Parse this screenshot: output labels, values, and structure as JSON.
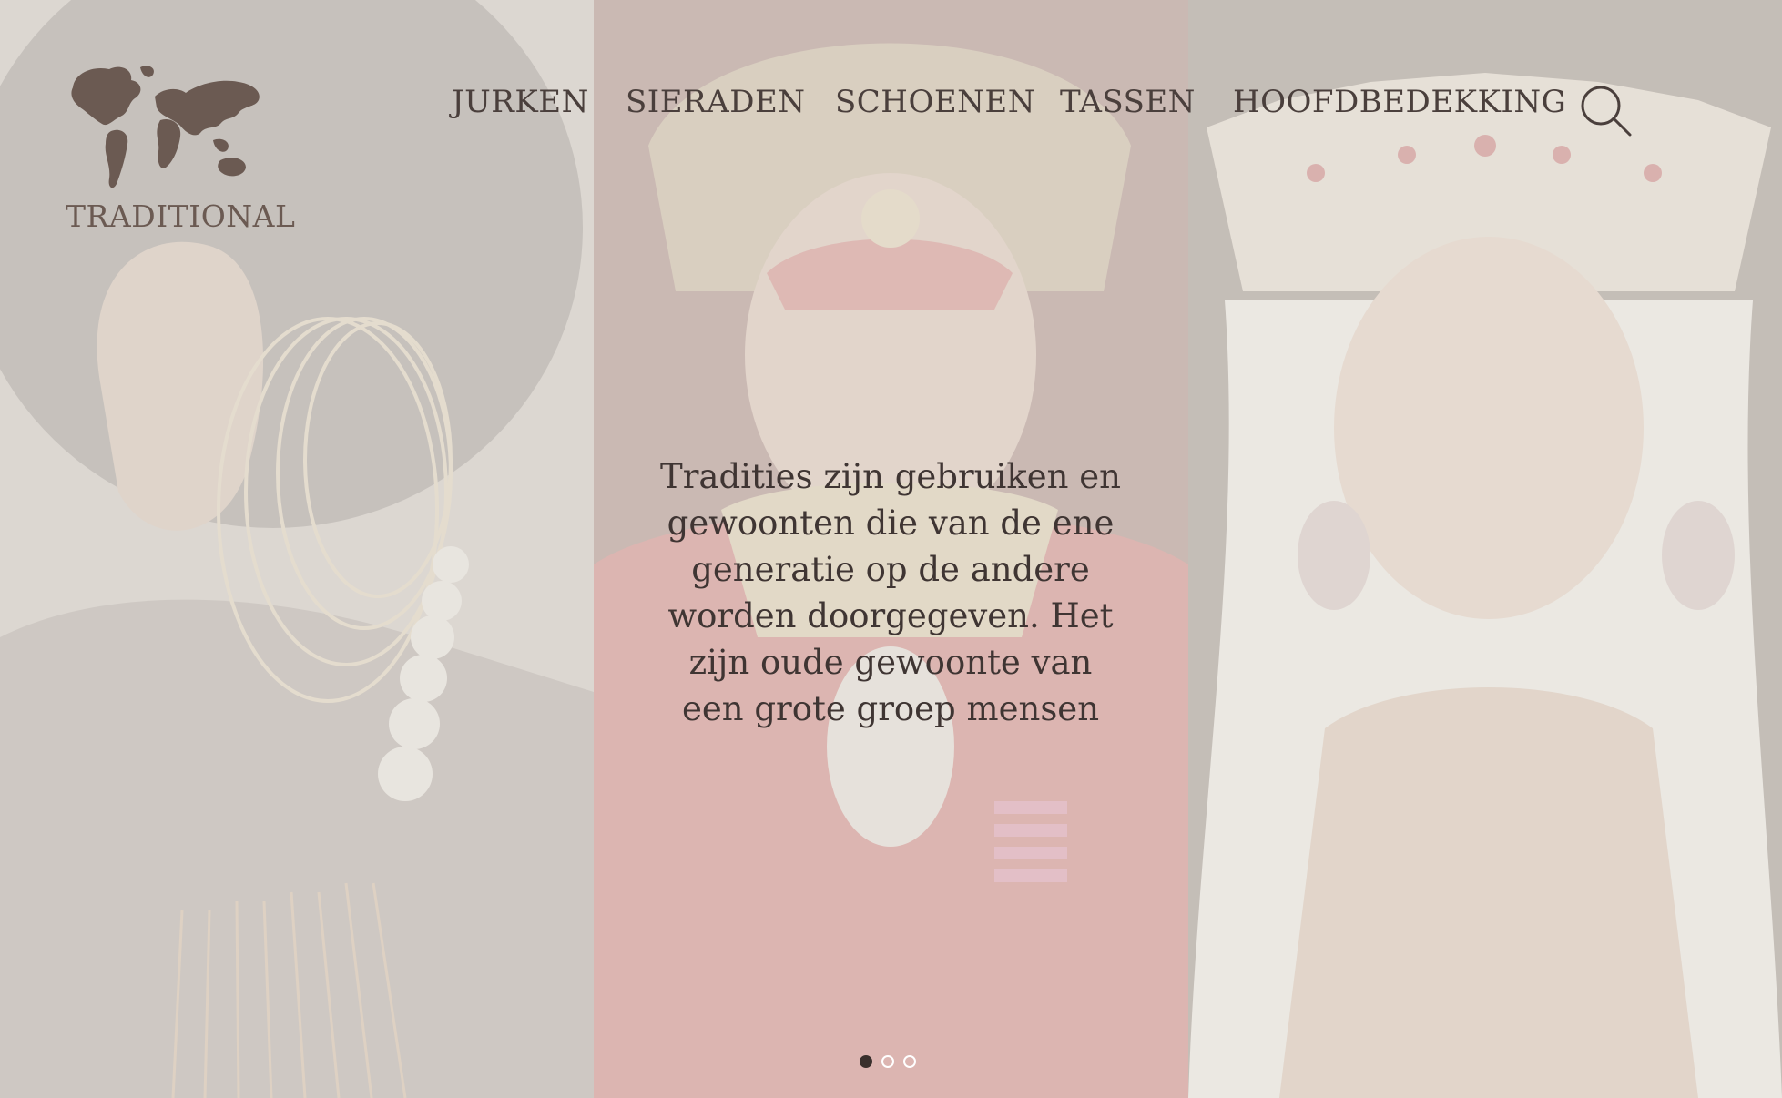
{
  "brand": {
    "logo_text": "TRADITIONAL",
    "logo_icon": "world-map-icon"
  },
  "nav": {
    "items": [
      {
        "label": "JURKEN"
      },
      {
        "label": "SIERADEN"
      },
      {
        "label": "SCHOENEN"
      },
      {
        "label": "TASSEN"
      },
      {
        "label": "HOOFDBEDEKKING"
      }
    ],
    "search_icon": "search-icon"
  },
  "hero": {
    "text": "Tradities zijn gebruiken en gewoonten die van de ene generatie op de andere worden doorgegeven. Het zijn oude gewoonte van een grote groep mensen"
  },
  "carousel": {
    "slide_count": 3,
    "active_index": 0
  },
  "colors": {
    "brand": "#6b5a52",
    "nav_text": "#4a3f3c",
    "overlay": "#e9e6e2",
    "active_dot": "#3a302d"
  }
}
